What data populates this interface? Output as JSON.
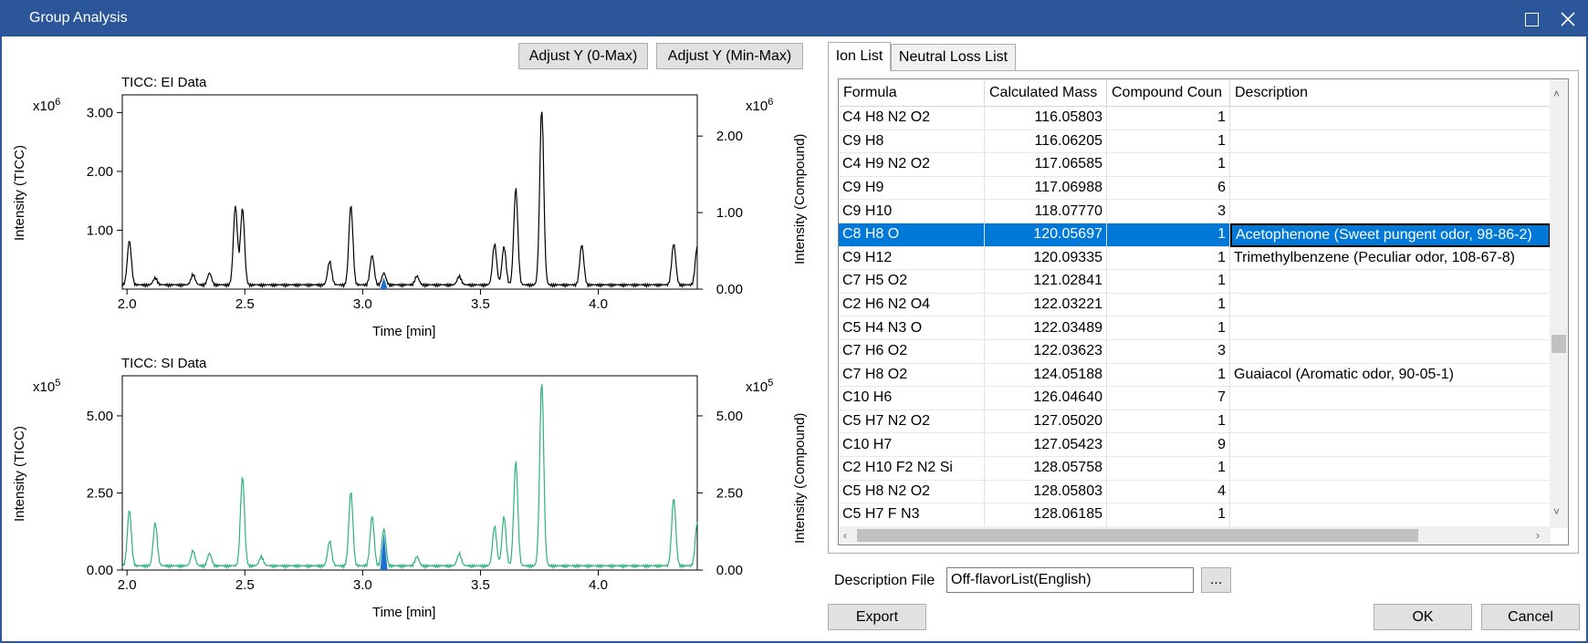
{
  "window": {
    "title": "Group Analysis"
  },
  "toolbar": {
    "adjust_y_0max": "Adjust Y (0-Max)",
    "adjust_y_minmax": "Adjust Y (Min-Max)"
  },
  "charts": {
    "ei": {
      "title": "TICC: EI Data",
      "exp_left": "x10",
      "exp_left_pow": "6",
      "exp_right": "x10",
      "exp_right_pow": "6",
      "xlabel": "Time [min]",
      "ylabel_left": "Intensity (TICC)",
      "ylabel_right": "Intensity (Compound)",
      "left_ticks": [
        "3.00",
        "2.00",
        "1.00"
      ],
      "right_ticks": [
        "2.00",
        "1.00",
        "0.00"
      ],
      "x_ticks": [
        "2.0",
        "2.5",
        "3.0",
        "3.5",
        "4.0"
      ]
    },
    "si": {
      "title": "TICC: SI Data",
      "exp_left": "x10",
      "exp_left_pow": "5",
      "exp_right": "x10",
      "exp_right_pow": "5",
      "xlabel": "Time [min]",
      "ylabel_left": "Intensity (TICC)",
      "ylabel_right": "Intensity (Compound)",
      "left_ticks": [
        "5.00",
        "2.50",
        "0.00"
      ],
      "right_ticks": [
        "5.00",
        "2.50",
        "0.00"
      ],
      "x_ticks": [
        "2.0",
        "2.5",
        "3.0",
        "3.5",
        "4.0"
      ]
    }
  },
  "chart_data": [
    {
      "type": "line",
      "title": "TICC: EI Data",
      "xlabel": "Time [min]",
      "ylabel": "Intensity (TICC)",
      "y2label": "Intensity (Compound)",
      "xlim": [
        1.98,
        4.42
      ],
      "ylim": [
        0,
        3.3
      ],
      "y_unit": "x10^6",
      "series": [
        {
          "color": "#000000",
          "peaks": [
            [
              2.01,
              0.75
            ],
            [
              2.12,
              0.12
            ],
            [
              2.28,
              0.18
            ],
            [
              2.35,
              0.2
            ],
            [
              2.46,
              1.35
            ],
            [
              2.49,
              1.3
            ],
            [
              2.86,
              0.4
            ],
            [
              2.95,
              1.35
            ],
            [
              3.04,
              0.5
            ],
            [
              3.09,
              0.2
            ],
            [
              3.23,
              0.15
            ],
            [
              3.41,
              0.15
            ],
            [
              3.56,
              0.7
            ],
            [
              3.6,
              0.65
            ],
            [
              3.65,
              1.65
            ],
            [
              3.76,
              3.0
            ],
            [
              3.93,
              0.68
            ],
            [
              4.32,
              0.7
            ],
            [
              4.42,
              0.65
            ]
          ]
        }
      ],
      "highlight": {
        "color": "#1e6fd0",
        "x": 3.09,
        "y": 0.2
      }
    },
    {
      "type": "line",
      "title": "TICC: SI Data",
      "xlabel": "Time [min]",
      "ylabel": "Intensity (TICC)",
      "y2label": "Intensity (Compound)",
      "xlim": [
        1.98,
        4.42
      ],
      "ylim": [
        0,
        6.3
      ],
      "y_unit": "x10^5",
      "series": [
        {
          "color": "#2db37a",
          "peaks": [
            [
              2.01,
              1.8
            ],
            [
              2.12,
              1.4
            ],
            [
              2.28,
              0.5
            ],
            [
              2.35,
              0.4
            ],
            [
              2.49,
              2.9
            ],
            [
              2.57,
              0.3
            ],
            [
              2.86,
              0.8
            ],
            [
              2.95,
              2.4
            ],
            [
              3.04,
              1.6
            ],
            [
              3.09,
              1.2
            ],
            [
              3.23,
              0.3
            ],
            [
              3.41,
              0.4
            ],
            [
              3.56,
              1.3
            ],
            [
              3.6,
              1.6
            ],
            [
              3.65,
              3.4
            ],
            [
              3.76,
              6.0
            ],
            [
              4.32,
              2.2
            ],
            [
              4.42,
              1.4
            ]
          ]
        }
      ],
      "highlight": {
        "color": "#1e6fd0",
        "x": 3.09,
        "y": 1.2
      }
    }
  ],
  "tabs": [
    {
      "label": "Ion List",
      "active": true
    },
    {
      "label": "Neutral Loss List",
      "active": false
    }
  ],
  "table": {
    "headers": [
      "Formula",
      "Calculated Mass",
      "Compound Coun",
      "Description"
    ],
    "rows": [
      [
        "C4 H8 N2 O2",
        "116.05803",
        "1",
        ""
      ],
      [
        "C9 H8",
        "116.06205",
        "1",
        ""
      ],
      [
        "C4 H9 N2 O2",
        "117.06585",
        "1",
        ""
      ],
      [
        "C9 H9",
        "117.06988",
        "6",
        ""
      ],
      [
        "C9 H10",
        "118.07770",
        "3",
        ""
      ],
      [
        "C8 H8 O",
        "120.05697",
        "1",
        "Acetophenone (Sweet pungent odor, 98-86-2)"
      ],
      [
        "C9 H12",
        "120.09335",
        "1",
        "Trimethylbenzene (Peculiar odor, 108-67-8)"
      ],
      [
        "C7 H5 O2",
        "121.02841",
        "1",
        ""
      ],
      [
        "C2 H6 N2 O4",
        "122.03221",
        "1",
        ""
      ],
      [
        "C5 H4 N3 O",
        "122.03489",
        "1",
        ""
      ],
      [
        "C7 H6 O2",
        "122.03623",
        "3",
        ""
      ],
      [
        "C7 H8 O2",
        "124.05188",
        "1",
        "Guaiacol (Aromatic odor, 90-05-1)"
      ],
      [
        "C10 H6",
        "126.04640",
        "7",
        ""
      ],
      [
        "C5 H7 N2 O2",
        "127.05020",
        "1",
        ""
      ],
      [
        "C10 H7",
        "127.05423",
        "9",
        ""
      ],
      [
        "C2 H10 F2 N2 Si",
        "128.05758",
        "1",
        ""
      ],
      [
        "C5 H8 N2 O2",
        "128.05803",
        "4",
        ""
      ],
      [
        "C5 H7 F N3",
        "128.06185",
        "1",
        ""
      ]
    ],
    "selected_index": 5
  },
  "description_file": {
    "label": "Description File",
    "value": "Off-flavorList(English)",
    "browse_label": "..."
  },
  "footer": {
    "export_label": "Export",
    "ok_label": "OK",
    "cancel_label": "Cancel"
  },
  "colors": {
    "titlebar": "#2b579a",
    "selection": "#0078d7",
    "ei_line": "#000000",
    "si_line": "#2db37a",
    "highlight": "#1e6fd0"
  }
}
